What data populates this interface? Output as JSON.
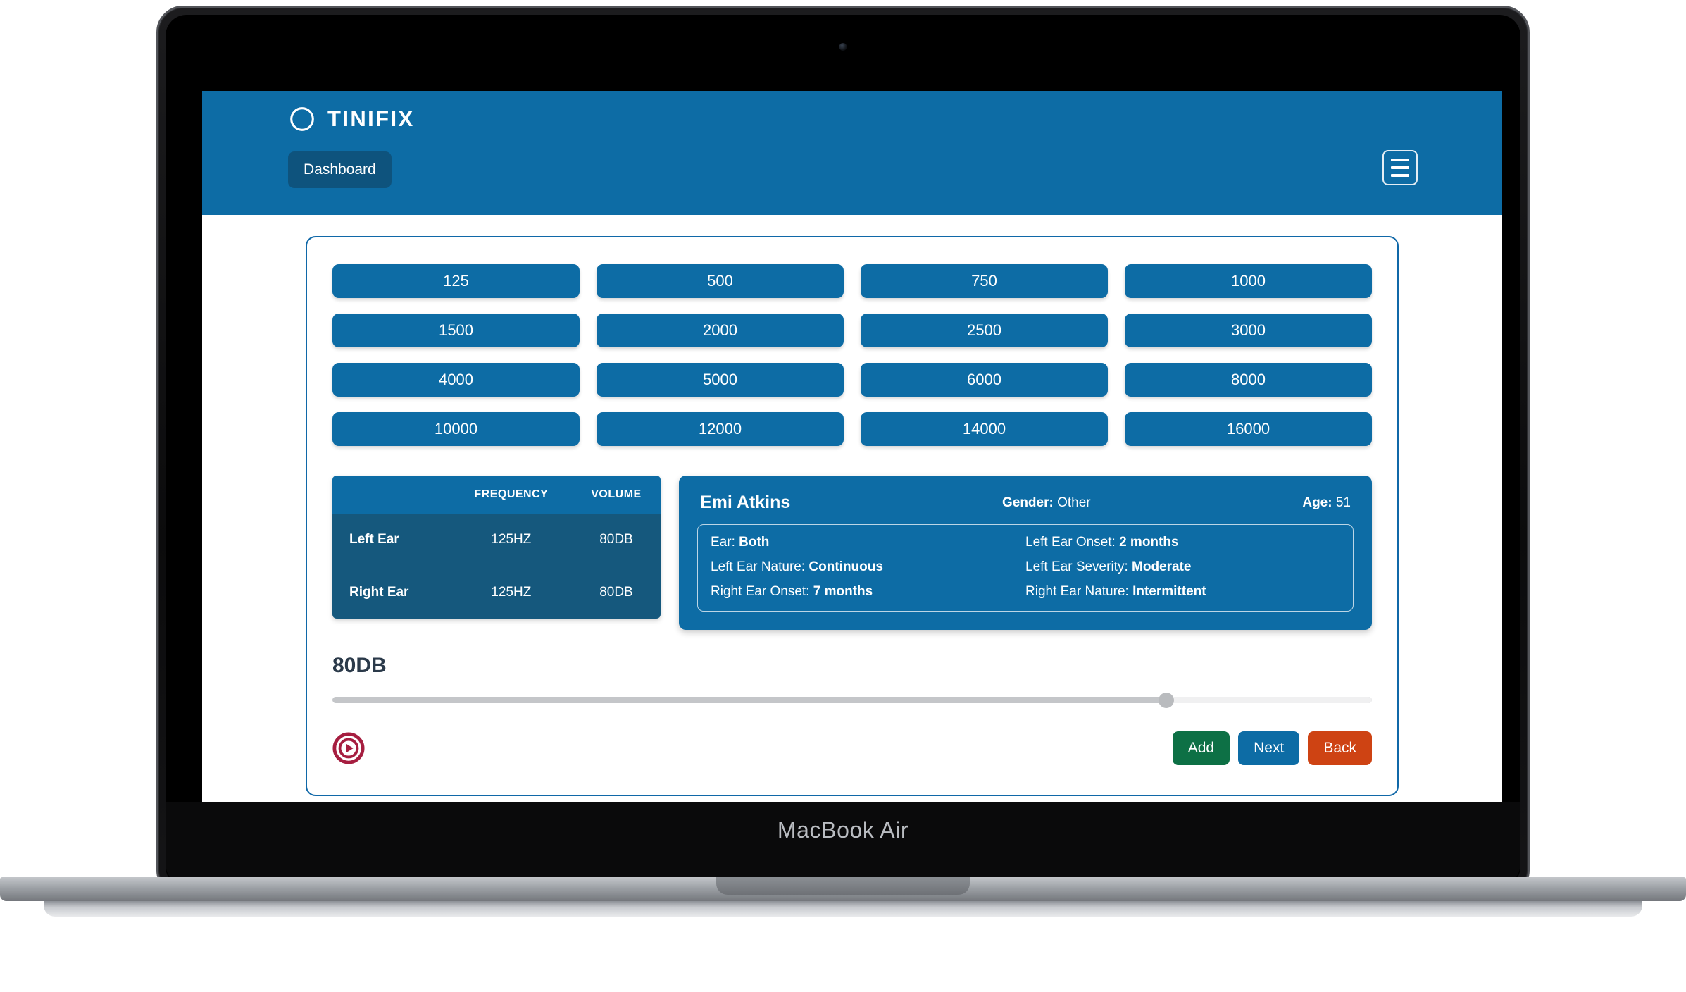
{
  "device": {
    "model_label": "MacBook Air",
    "camera_icon": "camera-dot-icon"
  },
  "topbar": {
    "brand_name": "TINIFIX",
    "brand_logo_icon": "crescent-circle-logo-icon",
    "nav_button": "Dashboard",
    "menu_icon": "hamburger-menu-icon",
    "background_color": "#0d6ca5",
    "nav_button_color": "#0e537d"
  },
  "frequencies": [
    "125",
    "500",
    "750",
    "1000",
    "1500",
    "2000",
    "2500",
    "3000",
    "4000",
    "5000",
    "6000",
    "8000",
    "10000",
    "12000",
    "14000",
    "16000"
  ],
  "results_table": {
    "headers": [
      "",
      "FREQUENCY",
      "VOLUME"
    ],
    "rows": [
      {
        "ear": "Left Ear",
        "frequency": "125HZ",
        "volume": "80DB"
      },
      {
        "ear": "Right Ear",
        "frequency": "125HZ",
        "volume": "80DB"
      }
    ]
  },
  "patient": {
    "name": "Emi Atkins",
    "gender_label": "Gender:",
    "gender_value": "Other",
    "age_label": "Age:",
    "age_value": "51",
    "details": [
      {
        "label": "Ear:",
        "value": "Both"
      },
      {
        "label": "Left Ear Onset:",
        "value": "2 months"
      },
      {
        "label": "Left Ear Nature:",
        "value": "Continuous"
      },
      {
        "label": "Left Ear Severity:",
        "value": "Moderate"
      },
      {
        "label": "Right Ear Onset:",
        "value": "7 months"
      },
      {
        "label": "Right Ear Nature:",
        "value": "Intermittent"
      }
    ]
  },
  "volume_control": {
    "display_value": "80DB",
    "slider_percent": 80,
    "play_icon": "play-circle-icon",
    "play_color": "#a61e40"
  },
  "actions": {
    "add_label": "Add",
    "next_label": "Next",
    "back_label": "Back",
    "add_color": "#0d7045",
    "next_color": "#0d6ca5",
    "back_color": "#ce4313"
  }
}
